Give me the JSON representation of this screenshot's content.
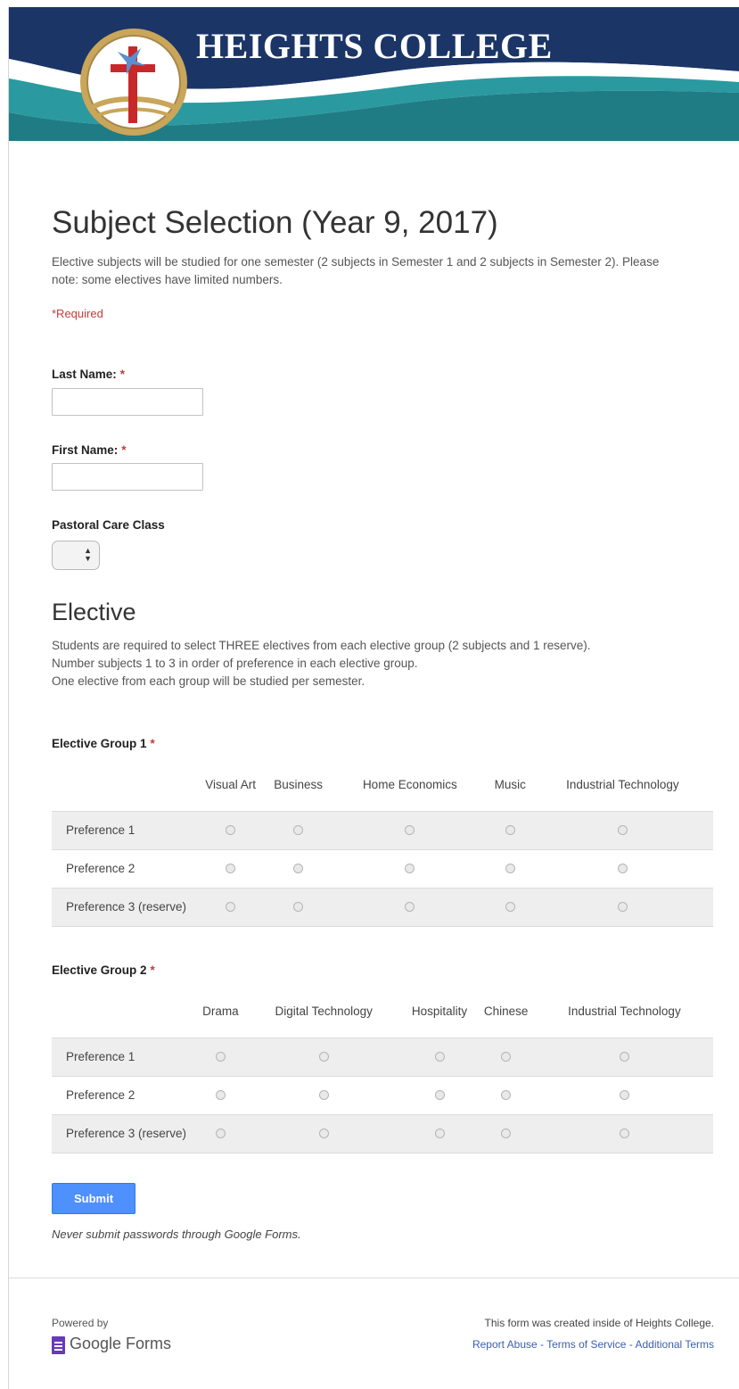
{
  "banner": {
    "title": "HEIGHTS COLLEGE"
  },
  "form": {
    "title": "Subject Selection (Year 9, 2017)",
    "description": "Elective subjects will be studied for one semester (2 subjects in Semester 1 and 2 subjects in Semester 2). Please note: some electives have limited numbers.",
    "required_note": "*Required",
    "fields": {
      "last_name": {
        "label": "Last Name:",
        "required_mark": "*",
        "value": ""
      },
      "first_name": {
        "label": "First Name:",
        "required_mark": "*",
        "value": ""
      },
      "pastoral_care": {
        "label": "Pastoral Care Class",
        "selected": ""
      }
    }
  },
  "elective": {
    "title": "Elective",
    "desc_line1": "Students are required to select THREE electives from each elective group (2 subjects and 1 reserve).",
    "desc_line2": "Number subjects 1 to 3 in order of preference in each elective group.",
    "desc_line3": "One elective from each group will be studied per semester.",
    "groups": [
      {
        "label": "Elective Group 1",
        "required_mark": "*",
        "columns": [
          "Visual Art",
          "Business",
          "Home Economics",
          "Music",
          "Industrial Technology"
        ],
        "rows": [
          "Preference 1",
          "Preference 2",
          "Preference 3 (reserve)"
        ]
      },
      {
        "label": "Elective Group 2",
        "required_mark": "*",
        "columns": [
          "Drama",
          "Digital Technology",
          "Hospitality",
          "Chinese",
          "Industrial Technology"
        ],
        "rows": [
          "Preference 1",
          "Preference 2",
          "Preference 3 (reserve)"
        ]
      }
    ]
  },
  "submit": {
    "label": "Submit",
    "note": "Never submit passwords through Google Forms."
  },
  "footer": {
    "powered_by": "Powered by",
    "google_forms": "Google Forms",
    "created_text": "This form was created inside of Heights College.",
    "link_report": "Report Abuse",
    "link_sep": " - ",
    "link_terms": "Terms of Service",
    "link_additional": "Additional Terms"
  },
  "colors": {
    "banner_navy": "#1b3567",
    "banner_teal": "#1f7c84",
    "required_red": "#c43b3b",
    "submit_blue": "#4d90fe",
    "link_blue": "#3a5fb0",
    "forms_purple": "#673ab7"
  },
  "icons": [
    "cross-logo-icon",
    "select-arrows-icon",
    "google-forms-icon"
  ]
}
